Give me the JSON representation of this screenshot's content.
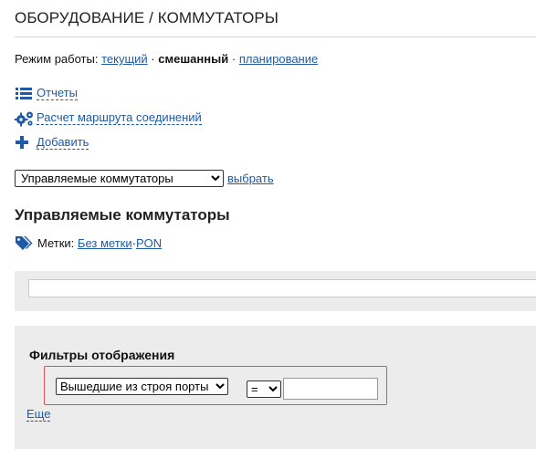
{
  "page": {
    "title": "ОБОРУДОВАНИЕ / КОММУТАТОРЫ"
  },
  "mode": {
    "label": "Режим работы:",
    "options": [
      "текущий",
      "смешанный",
      "планирование"
    ],
    "current": "смешанный",
    "separator": "·"
  },
  "actions": [
    {
      "label": "Отчеты",
      "icon": "list-icon"
    },
    {
      "label": "Расчет маршрута соединений",
      "icon": "gears-icon"
    },
    {
      "label": "Добавить",
      "icon": "plus-icon"
    }
  ],
  "switch_select": {
    "value": "Управляемые коммутаторы",
    "button": "выбрать"
  },
  "section": {
    "title": "Управляемые коммутаторы"
  },
  "tags": {
    "label": "Метки:",
    "items": [
      "Без метки",
      "PON"
    ],
    "separator": "·",
    "icon": "tags-icon"
  },
  "search": {
    "value": ""
  },
  "filters": {
    "title": "Фильтры отображения",
    "field": "Вышедшие из строя порты",
    "operator": "=",
    "value": "",
    "more": "Еще"
  },
  "colors": {
    "link": "#1f5aa6",
    "highlight_border": "#e05050",
    "panel_bg": "#ececec"
  }
}
